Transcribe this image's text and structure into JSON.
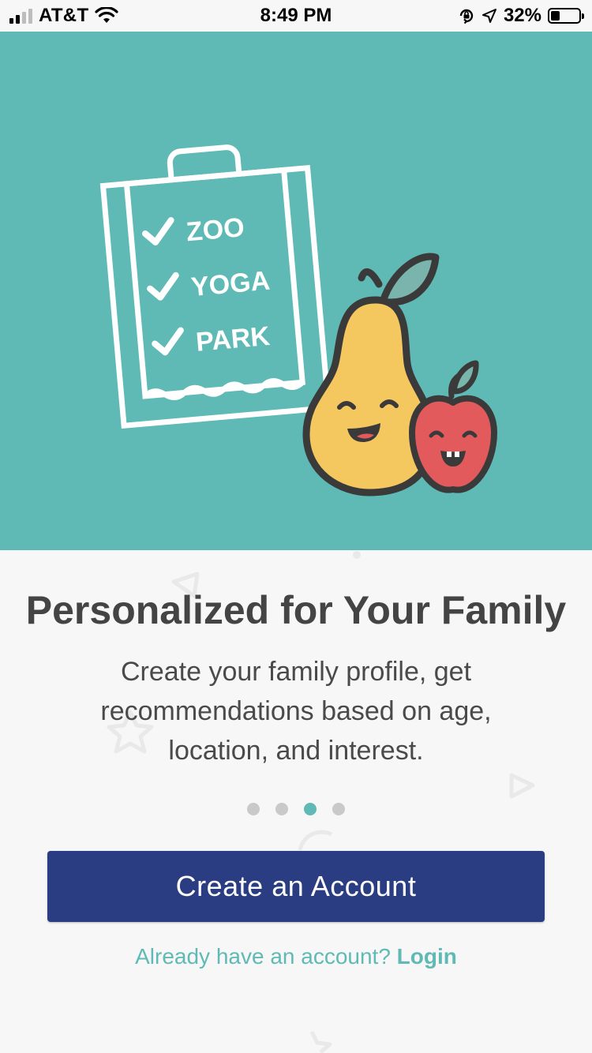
{
  "status_bar": {
    "carrier": "AT&T",
    "time": "8:49 PM",
    "battery_percent": "32%",
    "battery_level": 0.32,
    "icons": [
      "signal-icon",
      "wifi-icon",
      "orientation-lock-icon",
      "location-arrow-icon",
      "battery-icon"
    ]
  },
  "hero": {
    "background_color": "#5fbab5",
    "checklist": [
      "ZOO",
      "YOGA",
      "PARK"
    ]
  },
  "onboarding": {
    "title": "Personalized for Your Family",
    "description": "Create your family profile, get recommendations based on age, location, and interest.",
    "page_count": 4,
    "active_page": 3
  },
  "actions": {
    "create_account_label": "Create an Account",
    "login_prompt": "Already have an account? ",
    "login_label": "Login"
  },
  "colors": {
    "accent": "#5fbab5",
    "primary_button": "#2a3d82",
    "pear": "#f5c75f",
    "apple": "#e35a5c"
  }
}
